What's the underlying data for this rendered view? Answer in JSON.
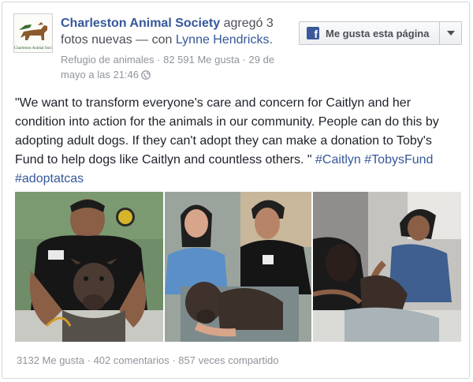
{
  "page": {
    "name": "Charleston Animal Society",
    "action": " agregó 3 fotos nuevas — con ",
    "tagged": "Lynne Hendricks",
    "tagged_suffix": ".",
    "avatar_caption": "Charleston Animal Society",
    "category": "Refugio de animales",
    "likes": "82 591 Me gusta",
    "timestamp": "29 de mayo a las 21:46",
    "separator": " · "
  },
  "like_button": {
    "label": "Me gusta esta página",
    "icon": "facebook-f-icon"
  },
  "post": {
    "text": "\"We want to transform everyone's care and concern for Caitlyn and her condition into action for the animals in our community. People can do this by adopting adult dogs. If they can't adopt they can make a donation to Toby's Fund to help dogs like Caitlyn and countless others. \"",
    "hashtags": [
      "#Caitlyn",
      "#TobysFund",
      "#adoptatcas"
    ]
  },
  "stats": {
    "likes": "3132 Me gusta",
    "comments": "402 comentarios",
    "shares": "857 veces compartido",
    "separator": " · "
  },
  "colors": {
    "link": "#365899",
    "meta": "#90949c",
    "fb_blue": "#3b5998"
  }
}
